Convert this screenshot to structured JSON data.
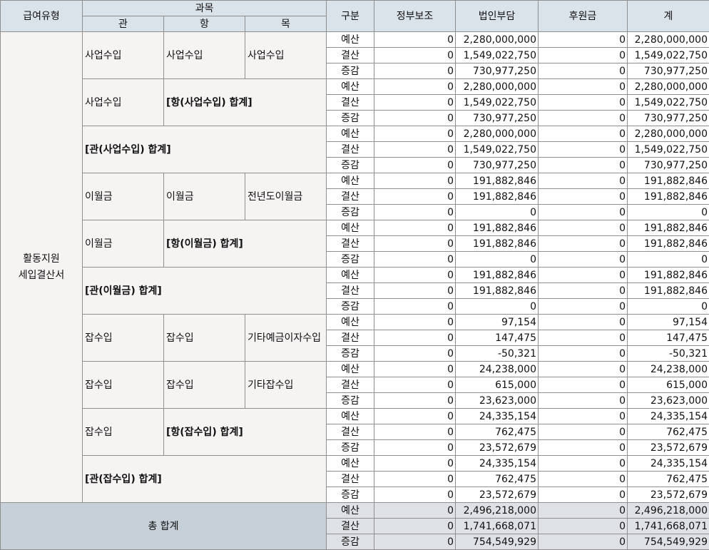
{
  "header": {
    "type_label": "급여유형",
    "subject_label": "과목",
    "gwan_label": "관",
    "hang_label": "항",
    "mok_label": "목",
    "gubun_label": "구분",
    "col_gov": "정부보조",
    "col_corp": "법인부담",
    "col_donation": "후원금",
    "col_total": "계"
  },
  "type_value": "활동지원\n세입결산서",
  "labels": {
    "g0": "사업수입",
    "h0": "사업수입",
    "m0": "사업수입",
    "g1": "사업수입",
    "h1": "[항(사업수입) 합계]",
    "g2": "[관(사업수입) 합계]",
    "g3": "이월금",
    "h3": "이월금",
    "m3": "전년도이월금",
    "g4": "이월금",
    "h4": "[항(이월금) 합계]",
    "g5": "[관(이월금) 합계]",
    "g6": "잡수입",
    "h6": "잡수입",
    "m6": "기타예금이자수입",
    "g7": "잡수입",
    "h7": "잡수입",
    "m7": "기타잡수입",
    "g8": "잡수입",
    "h8": "[항(잡수입) 합계]",
    "g9": "[관(잡수입) 합계]"
  },
  "grand_total_label": "총 합계",
  "rows": [
    {
      "gubun": "예산",
      "gov": "0",
      "corp": "2,280,000,000",
      "don": "0",
      "total": "2,280,000,000"
    },
    {
      "gubun": "결산",
      "gov": "0",
      "corp": "1,549,022,750",
      "don": "0",
      "total": "1,549,022,750"
    },
    {
      "gubun": "증감",
      "gov": "0",
      "corp": "730,977,250",
      "don": "0",
      "total": "730,977,250"
    },
    {
      "gubun": "예산",
      "gov": "0",
      "corp": "2,280,000,000",
      "don": "0",
      "total": "2,280,000,000"
    },
    {
      "gubun": "결산",
      "gov": "0",
      "corp": "1,549,022,750",
      "don": "0",
      "total": "1,549,022,750"
    },
    {
      "gubun": "증감",
      "gov": "0",
      "corp": "730,977,250",
      "don": "0",
      "total": "730,977,250"
    },
    {
      "gubun": "예산",
      "gov": "0",
      "corp": "2,280,000,000",
      "don": "0",
      "total": "2,280,000,000"
    },
    {
      "gubun": "결산",
      "gov": "0",
      "corp": "1,549,022,750",
      "don": "0",
      "total": "1,549,022,750"
    },
    {
      "gubun": "증감",
      "gov": "0",
      "corp": "730,977,250",
      "don": "0",
      "total": "730,977,250"
    },
    {
      "gubun": "예산",
      "gov": "0",
      "corp": "191,882,846",
      "don": "0",
      "total": "191,882,846"
    },
    {
      "gubun": "결산",
      "gov": "0",
      "corp": "191,882,846",
      "don": "0",
      "total": "191,882,846"
    },
    {
      "gubun": "증감",
      "gov": "0",
      "corp": "0",
      "don": "0",
      "total": "0"
    },
    {
      "gubun": "예산",
      "gov": "0",
      "corp": "191,882,846",
      "don": "0",
      "total": "191,882,846"
    },
    {
      "gubun": "결산",
      "gov": "0",
      "corp": "191,882,846",
      "don": "0",
      "total": "191,882,846"
    },
    {
      "gubun": "증감",
      "gov": "0",
      "corp": "0",
      "don": "0",
      "total": "0"
    },
    {
      "gubun": "예산",
      "gov": "0",
      "corp": "191,882,846",
      "don": "0",
      "total": "191,882,846"
    },
    {
      "gubun": "결산",
      "gov": "0",
      "corp": "191,882,846",
      "don": "0",
      "total": "191,882,846"
    },
    {
      "gubun": "증감",
      "gov": "0",
      "corp": "0",
      "don": "0",
      "total": "0"
    },
    {
      "gubun": "예산",
      "gov": "0",
      "corp": "97,154",
      "don": "0",
      "total": "97,154"
    },
    {
      "gubun": "결산",
      "gov": "0",
      "corp": "147,475",
      "don": "0",
      "total": "147,475"
    },
    {
      "gubun": "증감",
      "gov": "0",
      "corp": "-50,321",
      "don": "0",
      "total": "-50,321"
    },
    {
      "gubun": "예산",
      "gov": "0",
      "corp": "24,238,000",
      "don": "0",
      "total": "24,238,000"
    },
    {
      "gubun": "결산",
      "gov": "0",
      "corp": "615,000",
      "don": "0",
      "total": "615,000"
    },
    {
      "gubun": "증감",
      "gov": "0",
      "corp": "23,623,000",
      "don": "0",
      "total": "23,623,000"
    },
    {
      "gubun": "예산",
      "gov": "0",
      "corp": "24,335,154",
      "don": "0",
      "total": "24,335,154"
    },
    {
      "gubun": "결산",
      "gov": "0",
      "corp": "762,475",
      "don": "0",
      "total": "762,475"
    },
    {
      "gubun": "증감",
      "gov": "0",
      "corp": "23,572,679",
      "don": "0",
      "total": "23,572,679"
    },
    {
      "gubun": "예산",
      "gov": "0",
      "corp": "24,335,154",
      "don": "0",
      "total": "24,335,154"
    },
    {
      "gubun": "결산",
      "gov": "0",
      "corp": "762,475",
      "don": "0",
      "total": "762,475"
    },
    {
      "gubun": "증감",
      "gov": "0",
      "corp": "23,572,679",
      "don": "0",
      "total": "23,572,679"
    },
    {
      "gubun": "예산",
      "gov": "0",
      "corp": "2,496,218,000",
      "don": "0",
      "total": "2,496,218,000"
    },
    {
      "gubun": "결산",
      "gov": "0",
      "corp": "1,741,668,071",
      "don": "0",
      "total": "1,741,668,071"
    },
    {
      "gubun": "증감",
      "gov": "0",
      "corp": "754,549,929",
      "don": "0",
      "total": "754,549,929"
    }
  ]
}
